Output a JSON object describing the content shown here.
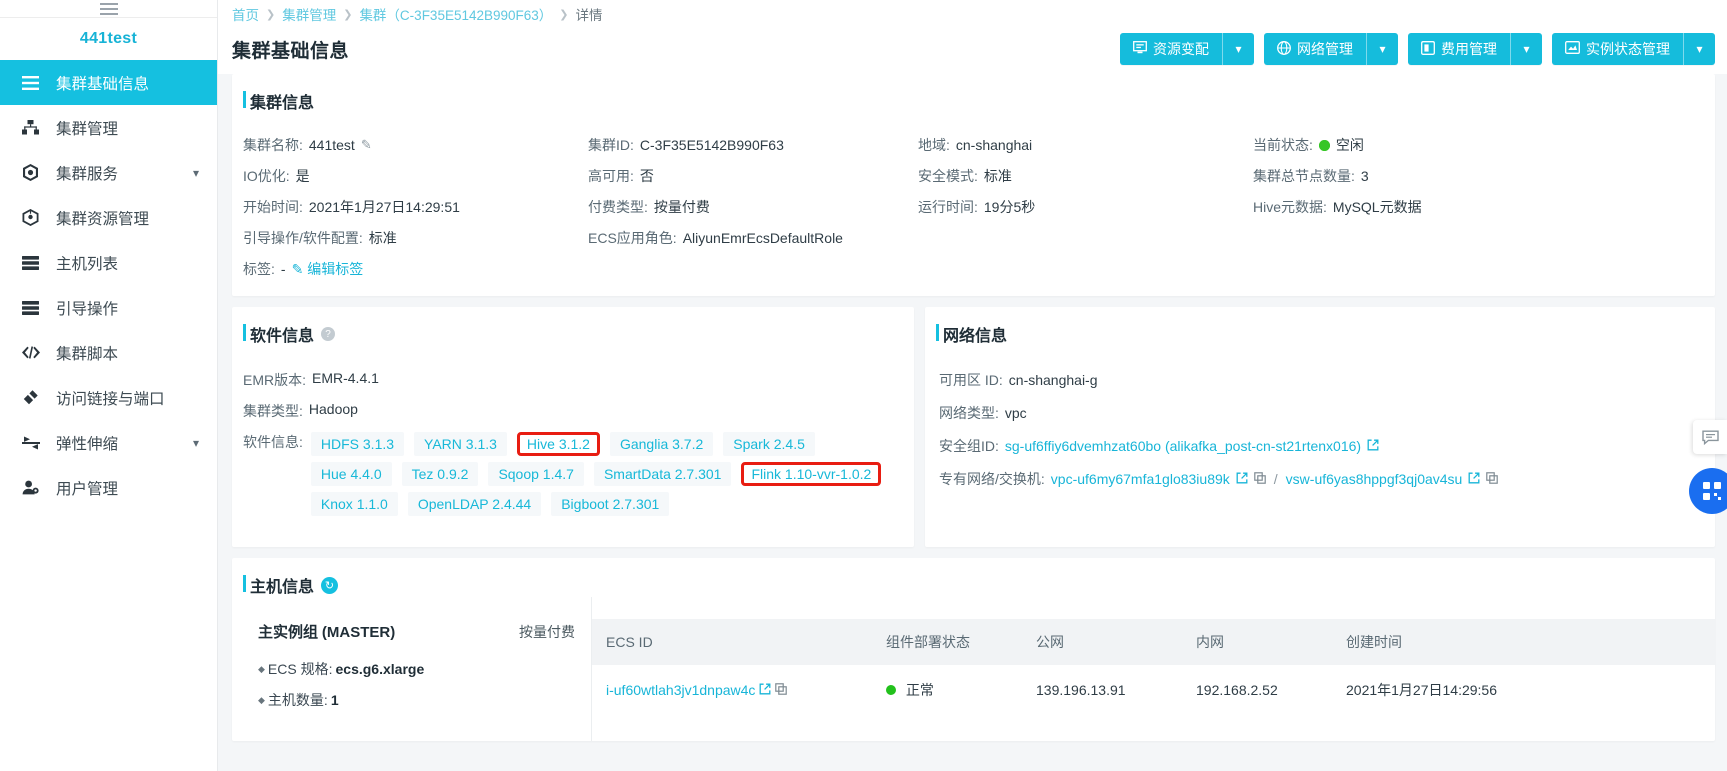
{
  "sidebar": {
    "cluster_name": "441test",
    "items": [
      {
        "label": "集群基础信息",
        "icon": "list-icon",
        "active": true,
        "expandable": false
      },
      {
        "label": "集群管理",
        "icon": "cluster-icon",
        "active": false,
        "expandable": false
      },
      {
        "label": "集群服务",
        "icon": "service-icon",
        "active": false,
        "expandable": true
      },
      {
        "label": "集群资源管理",
        "icon": "resource-icon",
        "active": false,
        "expandable": false
      },
      {
        "label": "主机列表",
        "icon": "server-icon",
        "active": false,
        "expandable": false
      },
      {
        "label": "引导操作",
        "icon": "bootstrap-icon",
        "active": false,
        "expandable": false
      },
      {
        "label": "集群脚本",
        "icon": "code-icon",
        "active": false,
        "expandable": false
      },
      {
        "label": "访问链接与端口",
        "icon": "link-icon",
        "active": false,
        "expandable": false
      },
      {
        "label": "弹性伸缩",
        "icon": "scale-icon",
        "active": false,
        "expandable": true
      },
      {
        "label": "用户管理",
        "icon": "user-icon",
        "active": false,
        "expandable": false
      }
    ]
  },
  "breadcrumb": {
    "home": "首页",
    "cluster_mgmt": "集群管理",
    "cluster": "集群（C-3F35E5142B990F63）",
    "current": "详情"
  },
  "header": {
    "title": "集群基础信息",
    "actions": [
      {
        "label": "资源变配",
        "icon": "monitor-icon"
      },
      {
        "label": "网络管理",
        "icon": "globe-icon"
      },
      {
        "label": "费用管理",
        "icon": "billing-icon"
      },
      {
        "label": "实例状态管理",
        "icon": "instance-icon"
      }
    ]
  },
  "cluster_info": {
    "section_title": "集群信息",
    "fields": [
      {
        "key": "集群名称:",
        "value": "441test",
        "editable": true
      },
      {
        "key": "集群ID:",
        "value": "C-3F35E5142B990F63"
      },
      {
        "key": "地域:",
        "value": "cn-shanghai"
      },
      {
        "key": "当前状态:",
        "value": "空闲",
        "status": true
      },
      {
        "key": "IO优化:",
        "value": "是"
      },
      {
        "key": "高可用:",
        "value": "否"
      },
      {
        "key": "安全模式:",
        "value": "标准"
      },
      {
        "key": "集群总节点数量:",
        "value": "3"
      },
      {
        "key": "开始时间:",
        "value": "2021年1月27日14:29:51"
      },
      {
        "key": "付费类型:",
        "value": "按量付费"
      },
      {
        "key": "运行时间:",
        "value": "19分5秒"
      },
      {
        "key": "Hive元数据:",
        "value": "MySQL元数据"
      },
      {
        "key": "引导操作/软件配置:",
        "value": "标准"
      },
      {
        "key": "ECS应用角色:",
        "value": "AliyunEmrEcsDefaultRole"
      },
      {
        "key": "",
        "value": ""
      },
      {
        "key": "",
        "value": ""
      },
      {
        "key": "标签:",
        "value": "-",
        "edit_label": "编辑标签"
      }
    ]
  },
  "software_info": {
    "section_title": "软件信息",
    "emr_version_key": "EMR版本:",
    "emr_version_value": "EMR-4.4.1",
    "cluster_type_key": "集群类型:",
    "cluster_type_value": "Hadoop",
    "software_key": "软件信息:",
    "tags": [
      {
        "label": "HDFS 3.1.3",
        "highlight": false
      },
      {
        "label": "YARN 3.1.3",
        "highlight": false
      },
      {
        "label": "Hive 3.1.2",
        "highlight": true
      },
      {
        "label": "Ganglia 3.7.2",
        "highlight": false
      },
      {
        "label": "Spark 2.4.5",
        "highlight": false
      },
      {
        "label": "Hue 4.4.0",
        "highlight": false
      },
      {
        "label": "Tez 0.9.2",
        "highlight": false
      },
      {
        "label": "Sqoop 1.4.7",
        "highlight": false
      },
      {
        "label": "SmartData 2.7.301",
        "highlight": false
      },
      {
        "label": "Flink 1.10-vvr-1.0.2",
        "highlight": true
      },
      {
        "label": "Knox 1.1.0",
        "highlight": false
      },
      {
        "label": "OpenLDAP 2.4.44",
        "highlight": false
      },
      {
        "label": "Bigboot 2.7.301",
        "highlight": false
      }
    ]
  },
  "network_info": {
    "section_title": "网络信息",
    "zone_key": "可用区 ID:",
    "zone_value": "cn-shanghai-g",
    "nettype_key": "网络类型:",
    "nettype_value": "vpc",
    "secgroup_key": "安全组ID:",
    "secgroup_value": "sg-uf6ffiy6dvemhzat60bo (alikafka_post-cn-st21rtenx016)",
    "vpc_key": "专有网络/交换机:",
    "vpc_value": "vpc-uf6my67mfa1glo83iu89k",
    "vswitch_value": "vsw-uf6yas8hppgf3qj0av4su"
  },
  "host_info": {
    "section_title": "主机信息",
    "group": {
      "name": "主实例组",
      "paren": "(MASTER)",
      "pay_type": "按量付费",
      "attrs": [
        {
          "key": "ECS 规格:",
          "value": "ecs.g6.xlarge"
        },
        {
          "key": "主机数量:",
          "value": "1"
        }
      ]
    },
    "columns": [
      "ECS ID",
      "组件部署状态",
      "公网",
      "内网",
      "创建时间"
    ],
    "rows": [
      {
        "ecs_id": "i-uf60wtlah3jv1dnpaw4c",
        "status": "正常",
        "public_ip": "139.196.13.91",
        "private_ip": "192.168.2.52",
        "created": "2021年1月27日14:29:56"
      }
    ]
  },
  "colors": {
    "accent": "#15c0e0",
    "link": "#18b5d8",
    "highlight": "#e81d12",
    "status_green": "#36c626",
    "float_blue": "#1a6ef0"
  }
}
